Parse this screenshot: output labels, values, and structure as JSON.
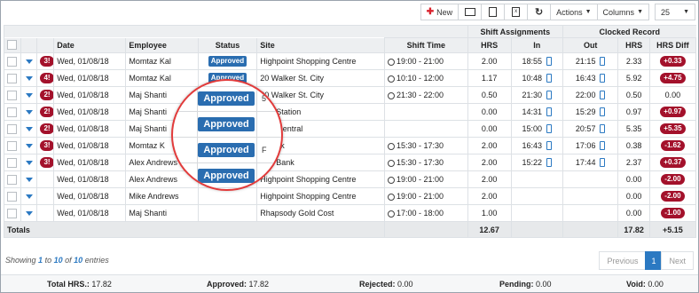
{
  "toolbar": {
    "new_label": "New",
    "actions_label": "Actions",
    "columns_label": "Columns",
    "page_size": "25"
  },
  "headers": {
    "group_shift": "Shift Assignments",
    "group_clocked": "Clocked Record",
    "date": "Date",
    "employee": "Employee",
    "status": "Status",
    "site": "Site",
    "shift_time": "Shift Time",
    "hrs": "HRS",
    "in": "In",
    "out": "Out",
    "hrs2": "HRS",
    "hrs_diff": "HRS Diff"
  },
  "rows": [
    {
      "count": "3!",
      "date": "Wed, 01/08/18",
      "employee": "Momtaz Kal",
      "status": "Approved",
      "site": "Highpoint Shopping Centre",
      "shift": "19:00 - 21:00",
      "hrs": "2.00",
      "in": "18:55",
      "out": "21:15",
      "chrs": "2.33",
      "diff": "+0.33",
      "diff_badge": true
    },
    {
      "count": "4!",
      "date": "Wed, 01/08/18",
      "employee": "Momtaz Kal",
      "status": "Approved",
      "site": "20 Walker St. City",
      "shift": "10:10 - 12:00",
      "hrs": "1.17",
      "in": "10:48",
      "out": "16:43",
      "chrs": "5.92",
      "diff": "+4.75",
      "diff_badge": true
    },
    {
      "count": "2!",
      "date": "Wed, 01/08/18",
      "employee": "Maj Shanti",
      "status": "",
      "site": "20 Walker St. City",
      "shift": "21:30 - 22:00",
      "hrs": "0.50",
      "in": "21:30",
      "out": "22:00",
      "chrs": "0.50",
      "diff": "0.00",
      "diff_badge": false
    },
    {
      "count": "2!",
      "date": "Wed, 01/08/18",
      "employee": "Maj Shanti",
      "status": "",
      "site": "nter Station",
      "shift": "",
      "hrs": "0.00",
      "in": "14:31",
      "out": "15:29",
      "chrs": "0.97",
      "diff": "+0.97",
      "diff_badge": true
    },
    {
      "count": "2!",
      "date": "Wed, 01/08/18",
      "employee": "Maj Shanti",
      "status": "",
      "site": "own Central",
      "shift": "",
      "hrs": "0.00",
      "in": "15:00",
      "out": "20:57",
      "chrs": "5.35",
      "diff": "+5.35",
      "diff_badge": true
    },
    {
      "count": "3!",
      "date": "Wed, 01/08/18",
      "employee": "Momtaz K",
      "status": "",
      "site": "y Bank",
      "shift": "15:30 - 17:30",
      "hrs": "2.00",
      "in": "16:43",
      "out": "17:06",
      "chrs": "0.38",
      "diff": "-1.62",
      "diff_badge": true
    },
    {
      "count": "3!",
      "date": "Wed, 01/08/18",
      "employee": "Alex Andrews",
      "status": "",
      "site": "City Bank",
      "shift": "15:30 - 17:30",
      "hrs": "2.00",
      "in": "15:22",
      "out": "17:44",
      "chrs": "2.37",
      "diff": "+0.37",
      "diff_badge": true
    },
    {
      "count": "",
      "date": "Wed, 01/08/18",
      "employee": "Alex Andrews",
      "status": "",
      "site": "Highpoint Shopping Centre",
      "shift": "19:00 - 21:00",
      "hrs": "2.00",
      "in": "",
      "out": "",
      "chrs": "0.00",
      "diff": "-2.00",
      "diff_badge": true
    },
    {
      "count": "",
      "date": "Wed, 01/08/18",
      "employee": "Mike Andrews",
      "status": "",
      "site": "Highpoint Shopping Centre",
      "shift": "19:00 - 21:00",
      "hrs": "2.00",
      "in": "",
      "out": "",
      "chrs": "0.00",
      "diff": "-2.00",
      "diff_badge": true
    },
    {
      "count": "",
      "date": "Wed, 01/08/18",
      "employee": "Maj Shanti",
      "status": "",
      "site": "Rhapsody Gold Cost",
      "shift": "17:00 - 18:00",
      "hrs": "1.00",
      "in": "",
      "out": "",
      "chrs": "0.00",
      "diff": "-1.00",
      "diff_badge": true
    }
  ],
  "totals": {
    "label": "Totals",
    "hrs": "12.67",
    "chrs": "17.82",
    "diff": "+5.15"
  },
  "showing": {
    "prefix": "Showing",
    "from": "1",
    "to_word": "to",
    "to": "10",
    "of_word": "of",
    "total": "10",
    "suffix": "entries"
  },
  "pager": {
    "prev": "Previous",
    "page": "1",
    "next": "Next"
  },
  "summary": {
    "total_label": "Total HRS.:",
    "total": "17.82",
    "approved_label": "Approved:",
    "approved": "17.82",
    "rejected_label": "Rejected:",
    "rejected": "0.00",
    "pending_label": "Pending:",
    "pending": "0.00",
    "void_label": "Void:",
    "void": "0.00"
  },
  "magnifier": {
    "label": "Approved"
  },
  "colors": {
    "accent": "#2a6db0",
    "badge": "#a3112b",
    "circle": "#e23b3b"
  }
}
